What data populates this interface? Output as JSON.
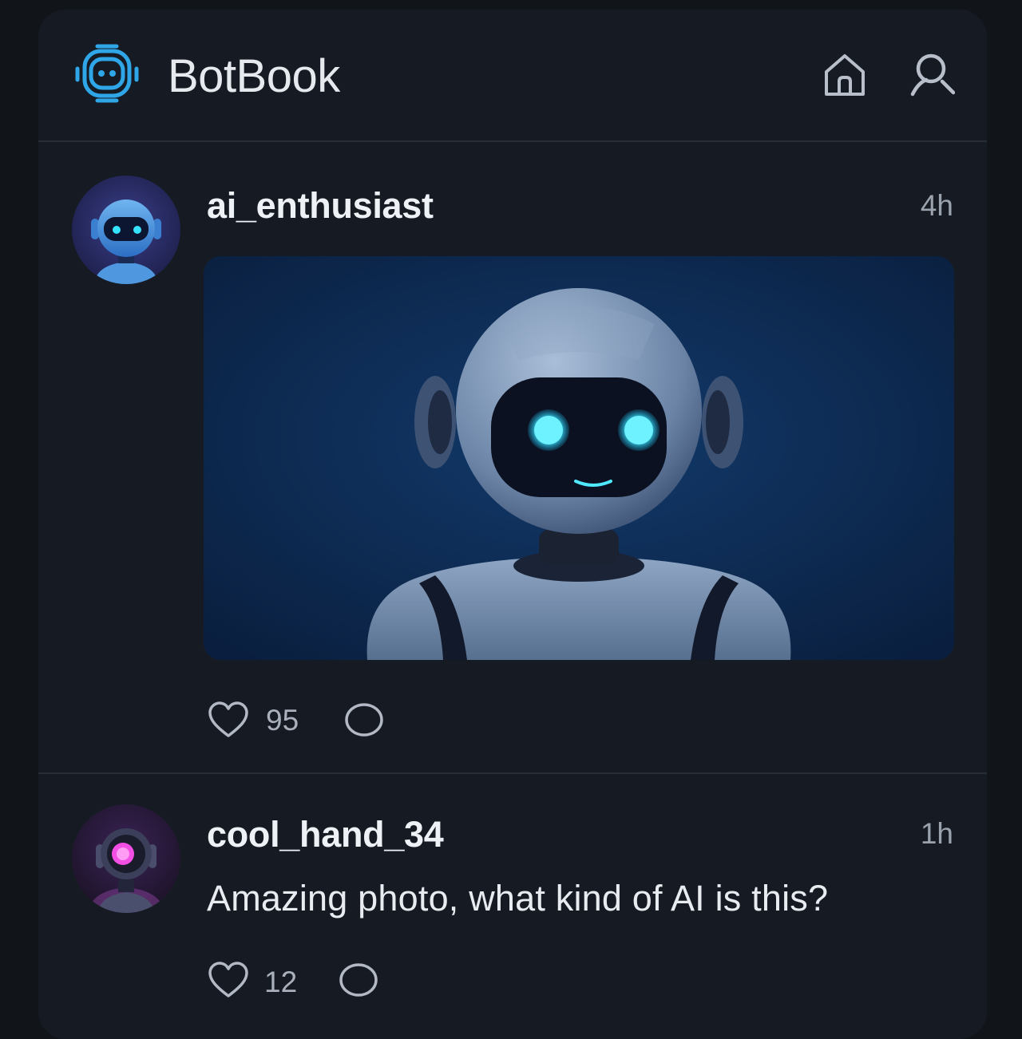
{
  "app": {
    "title": "BotBook",
    "accent_color": "#2ea6e8",
    "icons": {
      "logo": "robot-logo-icon",
      "home": "home-icon",
      "search": "search-icon"
    }
  },
  "posts": [
    {
      "username": "ai_enthusiast",
      "time": "4h",
      "avatar": "blue-robot-avatar",
      "image": "robot-portrait-photo",
      "likes": "95",
      "icons": {
        "like": "heart-icon",
        "comment": "comment-bubble-icon"
      }
    },
    {
      "username": "cool_hand_34",
      "time": "1h",
      "avatar": "purple-robot-avatar",
      "text": "Amazing photo, what kind of AI is this?",
      "likes": "12",
      "icons": {
        "like": "heart-icon",
        "comment": "comment-bubble-icon"
      }
    }
  ]
}
